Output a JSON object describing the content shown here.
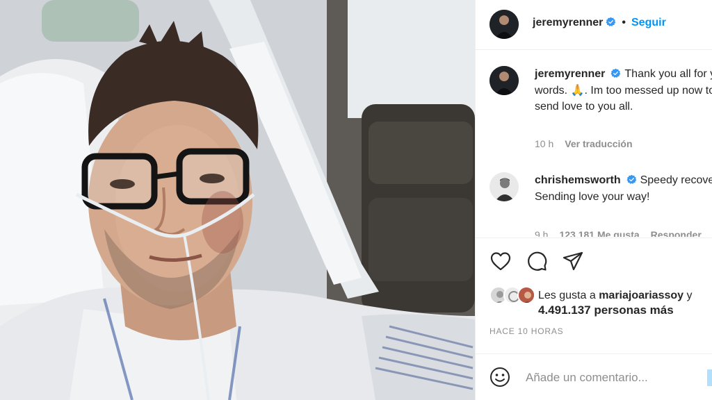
{
  "post": {
    "image_alt": "Selfie de hombre en cama de hospital con gafas y cánula nasal",
    "author": {
      "username": "jeremyrenner",
      "verified": true,
      "follow_label": "Seguir",
      "separator": "•"
    }
  },
  "comments": [
    {
      "username": "jeremyrenner",
      "verified": true,
      "text": "Thank you all for your kind words. 🙏. Im too messed up now to type. But I send love to you all.",
      "time": "10 h",
      "translate_label": "Ver traducción"
    },
    {
      "username": "chrishemsworth",
      "verified": true,
      "text": "Speedy recovery buddy. Sending love your way!",
      "time": "9 h",
      "likes": "123.181 Me gusta",
      "reply_label": "Responder"
    }
  ],
  "likes": {
    "prefix": "Les gusta a",
    "user": "mariajoariassoy",
    "conjunction": "y",
    "others": "4.491.137 personas más"
  },
  "timestamp": "HACE 10 HORAS",
  "add_comment": {
    "placeholder": "Añade un comentario..."
  },
  "icons": {
    "like": "heart-icon",
    "comment": "comment-icon",
    "share": "paper-plane-icon",
    "emoji": "smiley-icon",
    "verified": "verified-badge-icon"
  },
  "colors": {
    "accent": "#0095f6",
    "verified": "#3897f0",
    "text": "#262626",
    "muted": "#8e8e8e"
  }
}
